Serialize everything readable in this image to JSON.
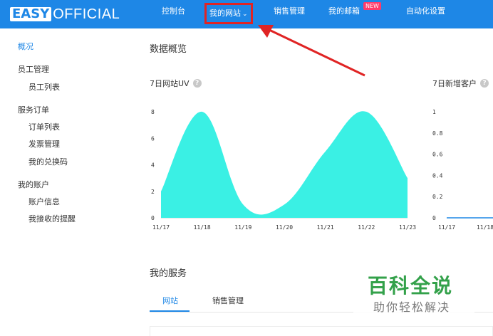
{
  "header": {
    "logo_easy": "EASY",
    "logo_official": "OFFICIAL",
    "nav": [
      "控制台",
      "我的网站",
      "销售管理",
      "我的邮箱",
      "自动化设置"
    ],
    "new_badge": "NEW",
    "chevron": "⌄",
    "brand_color": "#1e87e6",
    "highlight_color": "#e02424"
  },
  "sidebar": {
    "overview": "概况",
    "staff": "员工管理",
    "staff_list": "员工列表",
    "orders": "服务订单",
    "order_list": "订单列表",
    "invoice": "发票管理",
    "redeem": "我的兑换码",
    "account": "我的账户",
    "account_info": "账户信息",
    "reminders": "我接收的提醒"
  },
  "main": {
    "overview_title": "数据概览",
    "services_title": "我的服务",
    "tabs": [
      "网站",
      "销售管理"
    ],
    "help_icon": "?"
  },
  "chart_data": [
    {
      "type": "area",
      "title": "7日网站UV",
      "x": [
        "11/17",
        "11/18",
        "11/19",
        "11/20",
        "11/21",
        "11/22",
        "11/23"
      ],
      "series": [
        {
          "values": [
            2,
            8,
            1,
            1,
            5,
            8,
            3
          ]
        }
      ],
      "yticks": [
        0,
        2,
        4,
        6,
        8
      ],
      "ylim": [
        0,
        8
      ],
      "color": "#3af0e4",
      "grid": false
    },
    {
      "type": "line",
      "title": "7日新增客户",
      "x": [
        "11/17",
        "11/18"
      ],
      "series": [
        {
          "values": [
            0,
            0
          ]
        }
      ],
      "yticks": [
        "0",
        "0.2",
        "0.4",
        "0.6",
        "0.8",
        "1"
      ],
      "ylim": [
        0,
        1
      ],
      "color": "#1e87e6",
      "grid": false
    }
  ],
  "watermark": {
    "main": "百科全说",
    "sub": "助你轻松解决",
    "color": "#33a14a"
  }
}
